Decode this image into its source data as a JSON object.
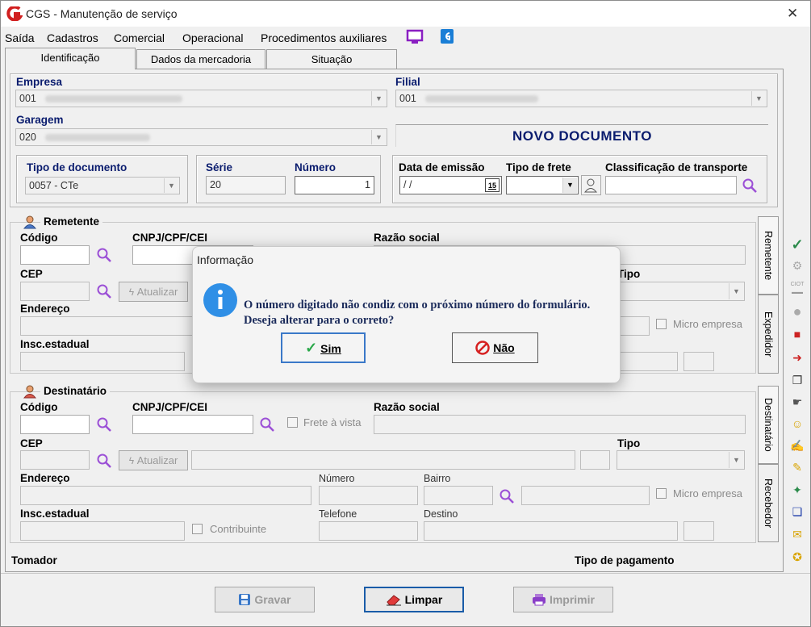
{
  "window": {
    "title": "CGS - Manutenção de serviço",
    "close": "✕"
  },
  "menu": [
    "Saída",
    "Cadastros",
    "Comercial",
    "Operacional",
    "Procedimentos auxiliares"
  ],
  "tabs": [
    "Identificação",
    "Dados da mercadoria",
    "Situação"
  ],
  "header": {
    "empresa_label": "Empresa",
    "empresa_value": "001",
    "filial_label": "Filial",
    "filial_value": "001",
    "garagem_label": "Garagem",
    "garagem_value": "020",
    "novo_documento": "NOVO DOCUMENTO"
  },
  "doc": {
    "tipo_label": "Tipo de documento",
    "tipo_value": "0057 - CTe",
    "serie_label": "Série",
    "serie_value": "20",
    "numero_label": "Número",
    "numero_value": "1",
    "data_label": "Data de emissão",
    "data_value": " / /",
    "cal_day": "15",
    "frete_label": "Tipo de frete",
    "classif_label": "Classificação de transporte"
  },
  "remetente": {
    "title": "Remetente",
    "codigo": "Código",
    "cnpj": "CNPJ/CPF/CEI",
    "razao": "Razão social",
    "cep": "CEP",
    "atualizar": "Atualizar",
    "tipo": "Tipo",
    "endereco": "Endereço",
    "micro": "Micro empresa",
    "insc": "Insc.estadual"
  },
  "side_tabs": [
    "Remetente",
    "Expedidor",
    "Destinatário",
    "Recebedor"
  ],
  "destinatario": {
    "title": "Destinatário",
    "codigo": "Código",
    "cnpj": "CNPJ/CPF/CEI",
    "frete_vista": "Frete à vista",
    "razao": "Razão social",
    "cep": "CEP",
    "atualizar": "Atualizar",
    "tipo": "Tipo",
    "endereco": "Endereço",
    "numero": "Número",
    "bairro": "Bairro",
    "micro": "Micro empresa",
    "insc": "Insc.estadual",
    "contribuinte": "Contribuinte",
    "telefone": "Telefone",
    "destino": "Destino"
  },
  "footer": {
    "tomador": "Tomador",
    "tipo_pagamento": "Tipo de pagamento"
  },
  "buttons": {
    "gravar": "Gravar",
    "limpar": "Limpar",
    "imprimir": "Imprimir"
  },
  "dialog": {
    "title": "Informação",
    "line1": "O número digitado não condiz com o próximo número do formulário.",
    "line2": "Deseja alterar para o correto?",
    "yes": "Sim",
    "no": "Não"
  },
  "colors": {
    "accent_blue": "#0a1c6e",
    "dialog_info": "#2f8fe6",
    "magnifier": "#9b4fd6",
    "no_red": "#d62020"
  }
}
